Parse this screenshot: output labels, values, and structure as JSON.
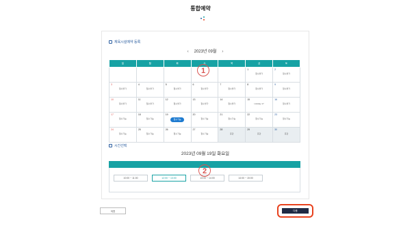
{
  "page": {
    "title": "통합예약"
  },
  "calendar_section": {
    "heading": "체육시설예약 등록",
    "month_label": "2023년 09월",
    "prev_arrow": "‹",
    "next_arrow": "›",
    "weekdays": [
      "일",
      "월",
      "화",
      "수",
      "목",
      "금",
      "토"
    ],
    "weeks": [
      [
        {
          "day": "",
          "status": ""
        },
        {
          "day": "",
          "status": ""
        },
        {
          "day": "",
          "status": ""
        },
        {
          "day": "",
          "status": ""
        },
        {
          "day": "",
          "status": ""
        },
        {
          "day": "1",
          "status": "접수불가"
        },
        {
          "day": "2",
          "status": "접수불가"
        }
      ],
      [
        {
          "day": "3",
          "status": "접수불가"
        },
        {
          "day": "4",
          "status": "접수불가"
        },
        {
          "day": "5",
          "status": "접수불가"
        },
        {
          "day": "6",
          "status": "접수불가"
        },
        {
          "day": "7",
          "status": "접수불가"
        },
        {
          "day": "8",
          "status": "접수불가"
        },
        {
          "day": "9",
          "status": "접수불가"
        }
      ],
      [
        {
          "day": "10",
          "status": "접수불가"
        },
        {
          "day": "11",
          "status": "접수불가"
        },
        {
          "day": "12",
          "status": "접수불가"
        },
        {
          "day": "13",
          "status": "접수불가"
        },
        {
          "day": "14",
          "status": "접수불가"
        },
        {
          "day": "15",
          "status": "Holiday 17"
        },
        {
          "day": "16",
          "status": "접수불가"
        }
      ],
      [
        {
          "day": "17",
          "status": "접수가능"
        },
        {
          "day": "18",
          "status": "접수가능"
        },
        {
          "day": "19",
          "status": "접수가능"
        },
        {
          "day": "20",
          "status": "접수가능"
        },
        {
          "day": "21",
          "status": "접수가능"
        },
        {
          "day": "22",
          "status": "접수가능"
        },
        {
          "day": "23",
          "status": "접수가능"
        }
      ],
      [
        {
          "day": "24",
          "status": "접수가능"
        },
        {
          "day": "25",
          "status": "접수가능"
        },
        {
          "day": "26",
          "status": "접수가능"
        },
        {
          "day": "27",
          "status": "접수가능"
        },
        {
          "day": "28",
          "status": "휴관"
        },
        {
          "day": "29",
          "status": "휴관"
        },
        {
          "day": "30",
          "status": "휴관"
        }
      ]
    ],
    "marker": "1"
  },
  "time_section": {
    "heading": "시간선택",
    "date_label": "2023년 09월 19일 화요일",
    "slots": [
      "10:00 ~ 11:00",
      "12:00 ~ 13:00",
      "13:00 ~ 14:00",
      "14:00 ~ 15:00"
    ],
    "marker": "2"
  },
  "buttons": {
    "prev": "이전",
    "next": "다음"
  },
  "colors": {
    "accent": "#17a2a4",
    "selected": "#1e7bd0",
    "highlight": "#e8401c",
    "next_button": "#1f2a44"
  }
}
